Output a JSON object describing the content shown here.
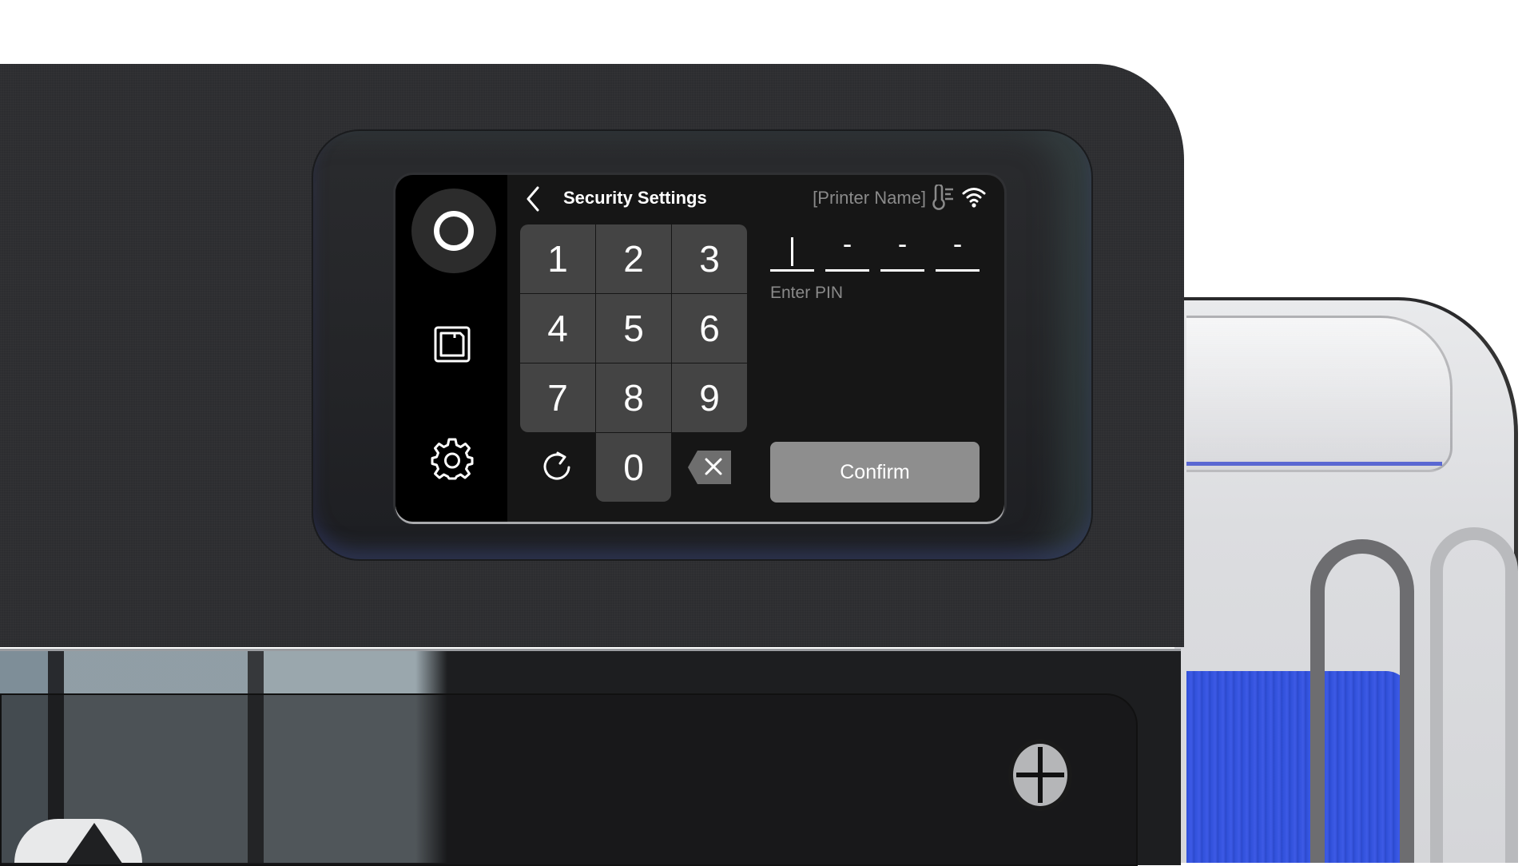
{
  "screen": {
    "sidebar": {
      "items": [
        {
          "id": "home",
          "icon": "home-ring-icon",
          "active": true
        },
        {
          "id": "files",
          "icon": "storage-icon",
          "active": false
        },
        {
          "id": "settings",
          "icon": "gear-icon",
          "active": false
        }
      ]
    },
    "header": {
      "back_icon": "chevron-left-icon",
      "title": "Security Settings",
      "printer_name": "[Printer Name]",
      "status_icons": [
        "thermometer-icon",
        "wifi-icon"
      ]
    },
    "keypad": {
      "keys": [
        "1",
        "2",
        "3",
        "4",
        "5",
        "6",
        "7",
        "8",
        "9",
        "0"
      ],
      "reset_icon": "refresh-icon",
      "backspace_icon": "backspace-icon"
    },
    "pin": {
      "slots": [
        "",
        "-",
        "-",
        "-"
      ],
      "label": "Enter PIN",
      "length": 4
    },
    "confirm_label": "Confirm",
    "colors": {
      "background": "#161616",
      "sidebar": "#000000",
      "key": "#444444",
      "confirm": "#8e8e8e",
      "muted_text": "#8a8a8a"
    }
  }
}
